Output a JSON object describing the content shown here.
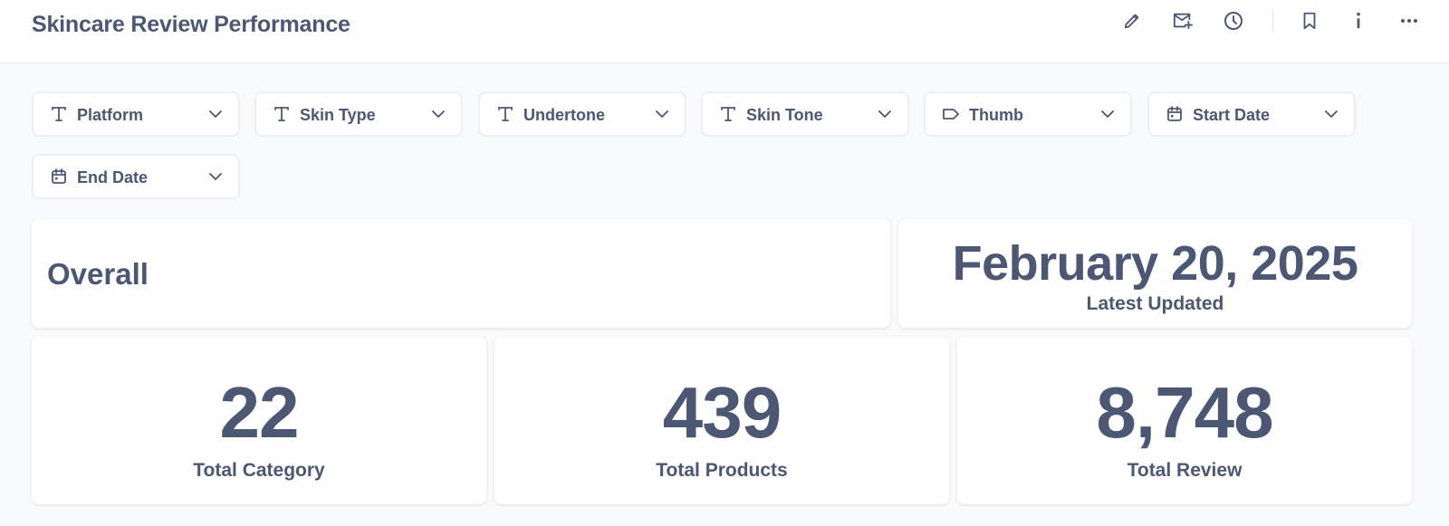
{
  "header": {
    "title": "Skincare Review Performance",
    "actions": [
      {
        "id": "edit",
        "icon": "pencil-icon"
      },
      {
        "id": "subscribe",
        "icon": "mail-plus-icon"
      },
      {
        "id": "history",
        "icon": "clock-icon"
      },
      {
        "id": "bookmark",
        "icon": "bookmark-icon"
      },
      {
        "id": "info",
        "icon": "info-icon"
      },
      {
        "id": "more",
        "icon": "ellipsis-icon"
      }
    ]
  },
  "filters": [
    {
      "label": "Platform",
      "icon": "text-type-icon"
    },
    {
      "label": "Skin Type",
      "icon": "text-type-icon"
    },
    {
      "label": "Undertone",
      "icon": "text-type-icon"
    },
    {
      "label": "Skin Tone",
      "icon": "text-type-icon"
    },
    {
      "label": "Thumb",
      "icon": "tag-icon"
    },
    {
      "label": "Start Date",
      "icon": "calendar-icon"
    },
    {
      "label": "End Date",
      "icon": "calendar-icon"
    }
  ],
  "overall": {
    "title": "Overall"
  },
  "latest": {
    "value": "February 20, 2025",
    "label": "Latest Updated"
  },
  "stats": [
    {
      "value": "22",
      "label": "Total Category"
    },
    {
      "value": "439",
      "label": "Total Products"
    },
    {
      "value": "8,748",
      "label": "Total Review"
    }
  ],
  "colors": {
    "text": "#4c5773",
    "background": "#f9fafc",
    "card": "#ffffff",
    "border": "#eceef2"
  }
}
